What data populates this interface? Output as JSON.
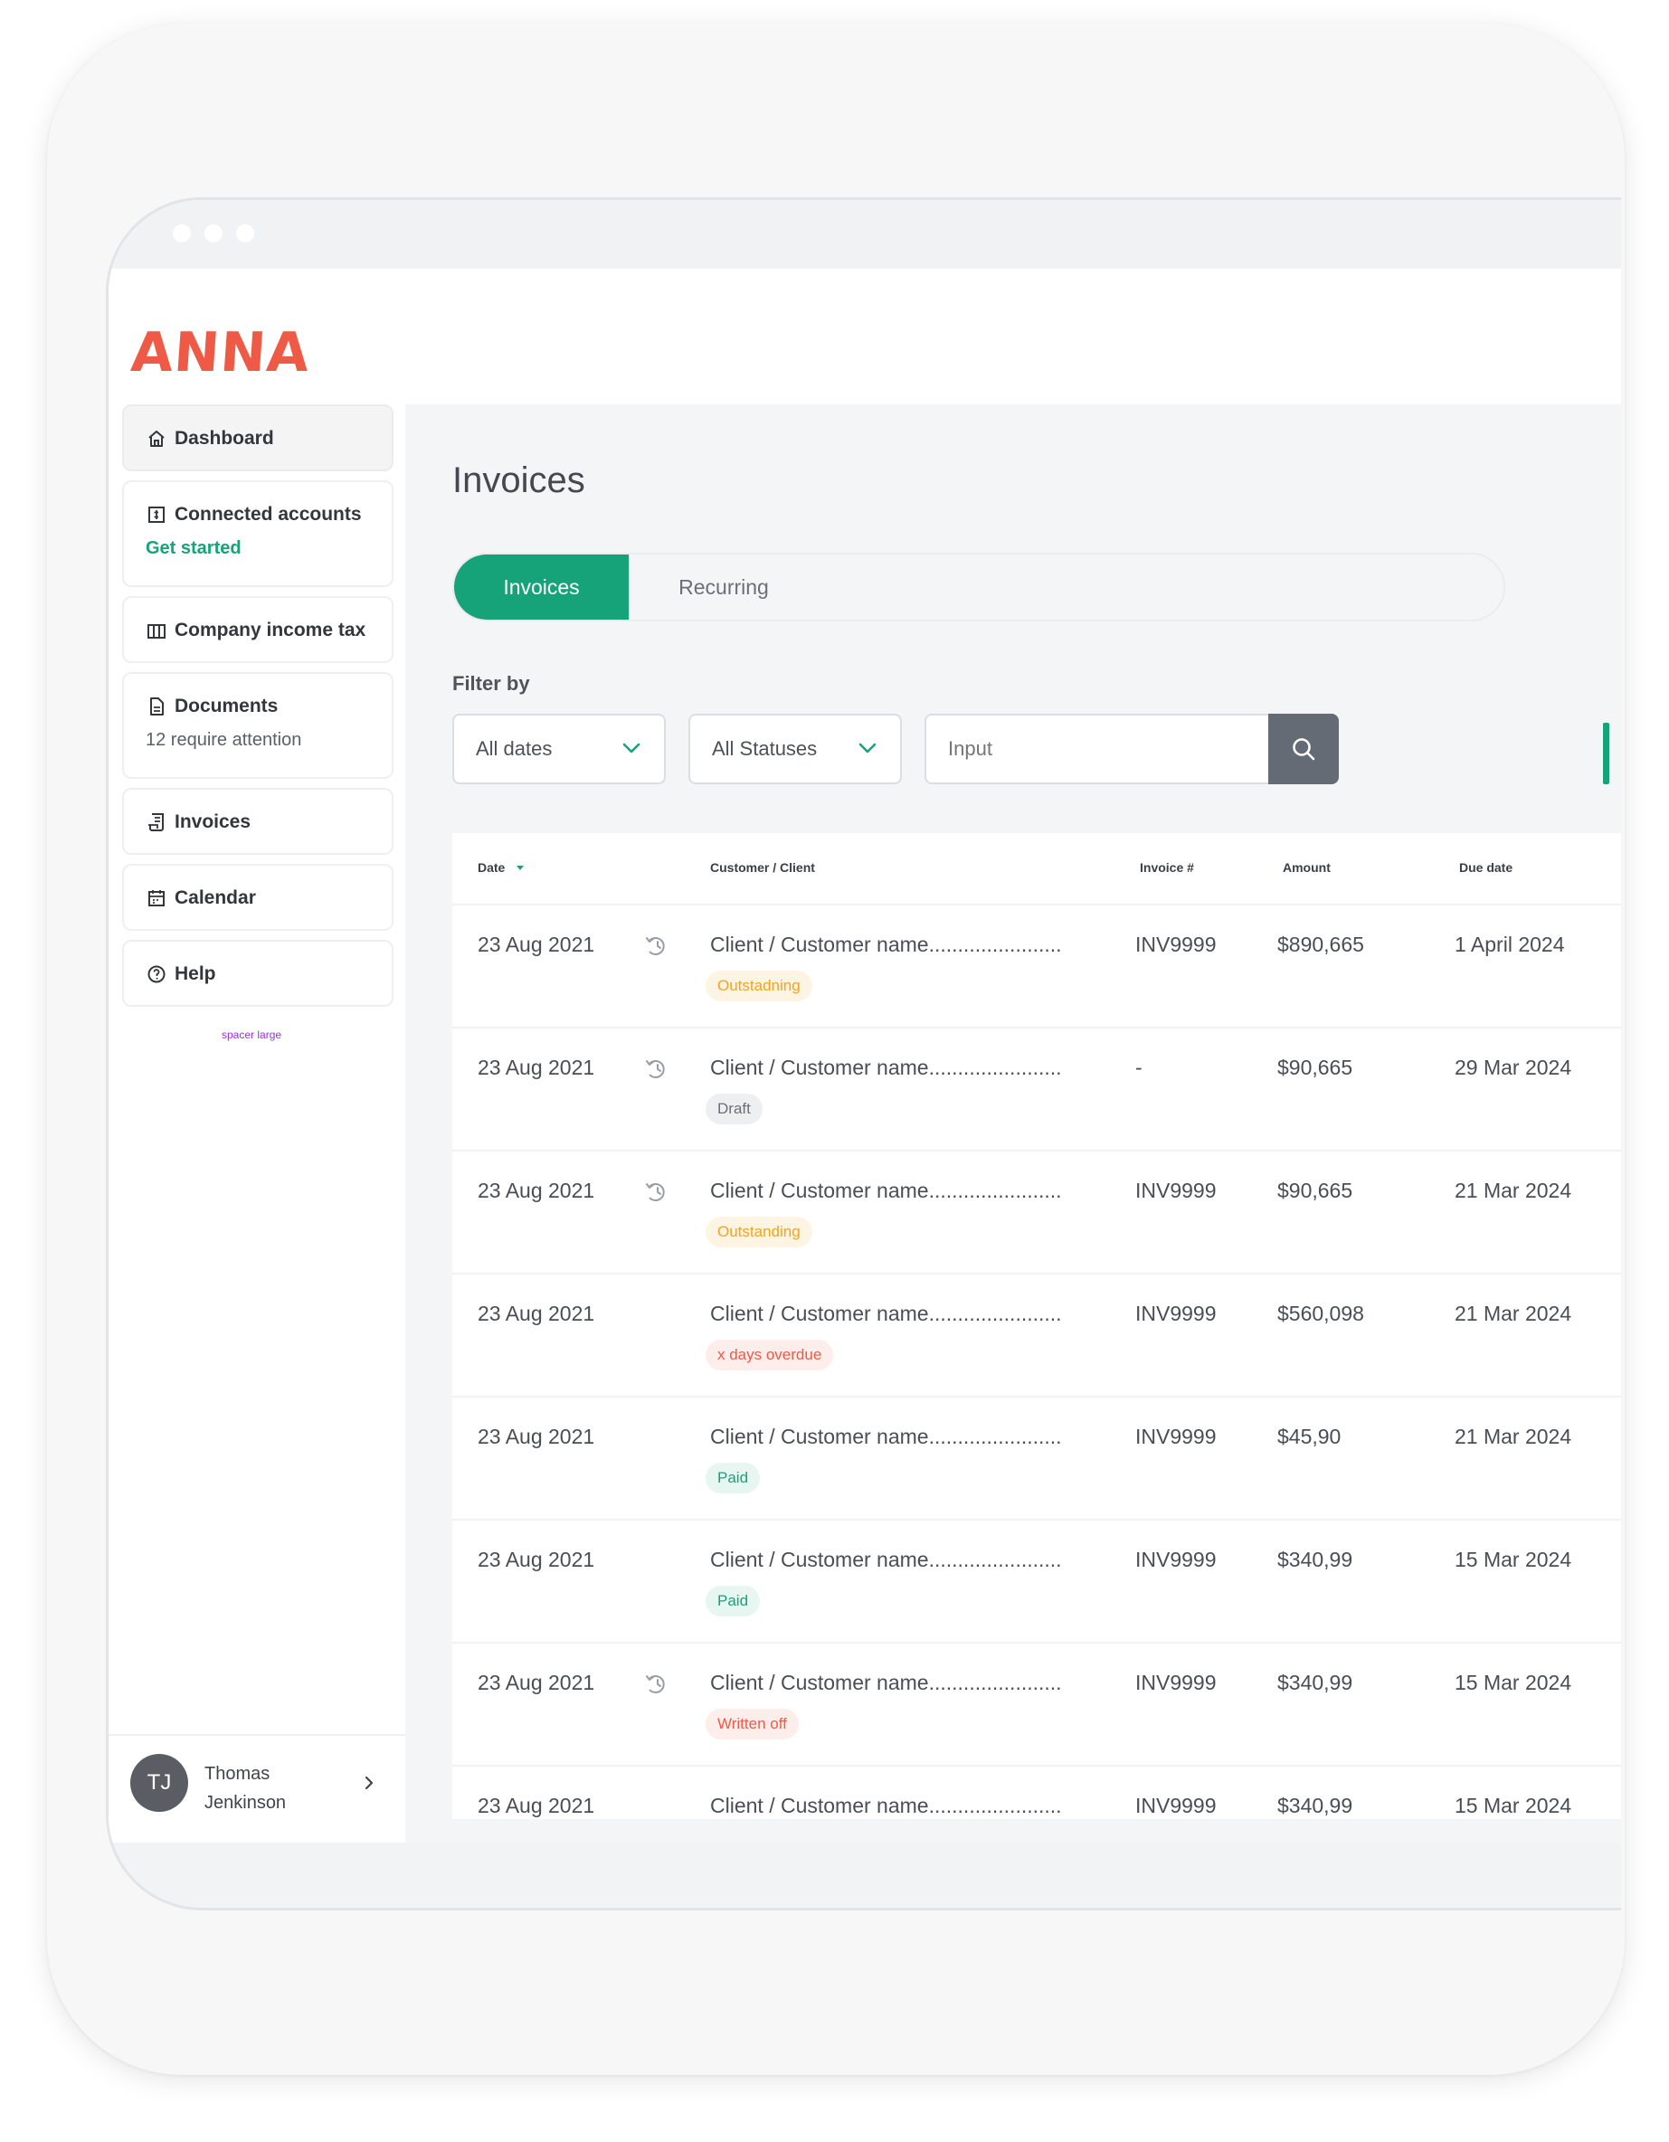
{
  "app": {
    "logo": "ANNA"
  },
  "sidebar": {
    "items": [
      {
        "label": "Dashboard",
        "icon": "home-icon"
      },
      {
        "label": "Connected accounts",
        "sub": "Get started",
        "icon": "bank-icon"
      },
      {
        "label": "Company income tax",
        "icon": "columns-icon"
      },
      {
        "label": "Documents",
        "sub": "12 require attention",
        "icon": "document-icon"
      },
      {
        "label": "Invoices",
        "icon": "invoice-icon"
      },
      {
        "label": "Calendar",
        "icon": "calendar-icon"
      },
      {
        "label": "Help",
        "icon": "help-icon"
      }
    ],
    "spacer_label": "spacer large",
    "user": {
      "initials": "TJ",
      "name": "Thomas Jenkinson"
    }
  },
  "main": {
    "title": "Invoices",
    "tabs": [
      {
        "label": "Invoices",
        "active": true
      },
      {
        "label": "Recurring",
        "active": false
      }
    ],
    "filter": {
      "label": "Filter by",
      "dates": "All dates",
      "statuses": "All Statuses",
      "search_placeholder": "Input"
    },
    "table": {
      "columns": [
        "Date",
        "Customer / Client",
        "Invoice #",
        "Amount",
        "Due date"
      ],
      "rows": [
        {
          "date": "23 Aug 2021",
          "history": true,
          "customer": "Client / Customer name.......................",
          "status": "Outstadning",
          "status_color": "orange",
          "invoice": "INV9999",
          "amount": "$890,665",
          "due": "1 April 2024"
        },
        {
          "date": "23 Aug 2021",
          "history": true,
          "customer": "Client / Customer name.......................",
          "status": "Draft",
          "status_color": "grey",
          "invoice": "-",
          "amount": "$90,665",
          "due": "29 Mar 2024"
        },
        {
          "date": "23 Aug 2021",
          "history": true,
          "customer": "Client / Customer name.......................",
          "status": "Outstanding",
          "status_color": "orange",
          "invoice": "INV9999",
          "amount": "$90,665",
          "due": "21 Mar 2024"
        },
        {
          "date": "23 Aug 2021",
          "history": false,
          "customer": "Client / Customer name.......................",
          "status": "x days overdue",
          "status_color": "red",
          "invoice": "INV9999",
          "amount": "$560,098",
          "due": "21 Mar 2024"
        },
        {
          "date": "23 Aug 2021",
          "history": false,
          "customer": "Client / Customer name.......................",
          "status": "Paid",
          "status_color": "green",
          "invoice": "INV9999",
          "amount": "$45,90",
          "due": "21 Mar 2024"
        },
        {
          "date": "23 Aug 2021",
          "history": false,
          "customer": "Client / Customer name.......................",
          "status": "Paid",
          "status_color": "green",
          "invoice": "INV9999",
          "amount": "$340,99",
          "due": "15 Mar 2024"
        },
        {
          "date": "23 Aug 2021",
          "history": true,
          "customer": "Client / Customer name.......................",
          "status": "Written off",
          "status_color": "red",
          "invoice": "INV9999",
          "amount": "$340,99",
          "due": "15 Mar 2024"
        },
        {
          "date": "23 Aug 2021",
          "history": false,
          "customer": "Client / Customer name.......................",
          "status": "",
          "status_color": "none",
          "invoice": "INV9999",
          "amount": "$340,99",
          "due": "15 Mar 2024"
        }
      ]
    }
  },
  "colors": {
    "brand": "#ee5a45",
    "accent": "#17a37a",
    "search_button": "#656b74"
  }
}
